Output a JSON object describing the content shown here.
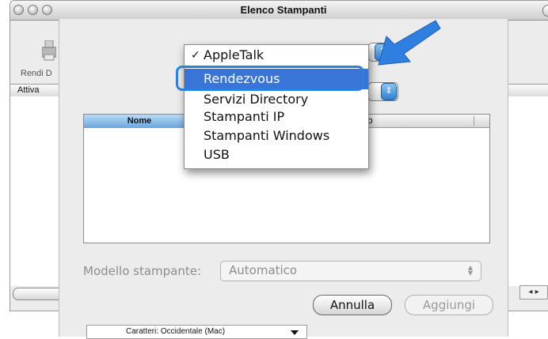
{
  "window": {
    "title": "Elenco Stampanti"
  },
  "toolbar": {
    "rendi_label": "Rendi D"
  },
  "column_strip": {
    "label": "Attiva"
  },
  "sheet": {
    "list_headers": {
      "name": "Nome",
      "type": "ipo"
    },
    "encoding": {
      "selected": "Caratteri: Occidentale (Mac)"
    },
    "printer_model": {
      "label": "Modello stampante:",
      "value": "Automatico"
    },
    "buttons": {
      "cancel": "Annulla",
      "add": "Aggiungi"
    }
  },
  "menu": {
    "items": [
      {
        "label": "AppleTalk",
        "checked": true
      },
      {
        "label": "Rendezvous",
        "selected": true
      },
      {
        "label": "Servizi Directory"
      },
      {
        "label": "Stampanti IP"
      },
      {
        "label": "Stampanti Windows"
      },
      {
        "label": "USB"
      }
    ],
    "check_glyph": "✓"
  },
  "colors": {
    "selection": "#3875d7",
    "arrow": "#2f7fe0"
  },
  "icons": [
    "stepper-icon",
    "disclosure-triangle-icon",
    "printer-icon",
    "pointer-arrow-icon"
  ]
}
